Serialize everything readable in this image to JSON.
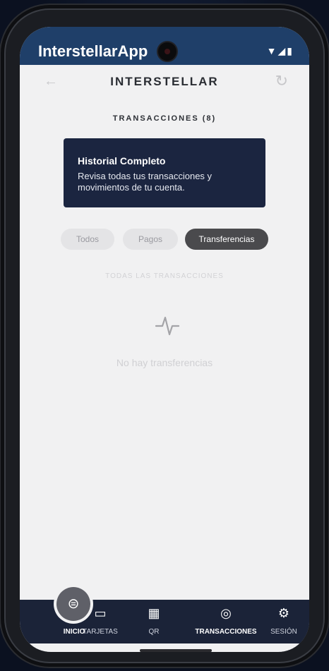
{
  "status_bar": {
    "app_title": "InterstellarApp",
    "icons": "▼◢▮"
  },
  "header": {
    "title": "INTERSTELLAR",
    "back_icon": "←",
    "refresh_icon": "↻"
  },
  "section": {
    "title": "TRANSACCIONES (8)"
  },
  "card": {
    "title": "Historial Completo",
    "description": "Revisa todas tus transacciones y movimientos de tu cuenta."
  },
  "filters": {
    "todos": "Todos",
    "pagos": "Pagos",
    "transferencias": "Transferencias",
    "active": "Transferencias"
  },
  "list": {
    "label": "TODAS LAS TRANSACCIONES",
    "empty_text": "No hay transferencias"
  },
  "bottom_nav": {
    "inicio": "INICIO",
    "tarjetas": "TARJETAS",
    "qr": "QR",
    "transacciones": "TRANSACCIONES",
    "sesion": "SESIÓN",
    "active": "TRANSACCIONES"
  },
  "colors": {
    "status_bar": "#1f3f69",
    "card": "#1b2540",
    "active_pill": "#4a4a4d",
    "nav_bar": "#1b2338"
  }
}
